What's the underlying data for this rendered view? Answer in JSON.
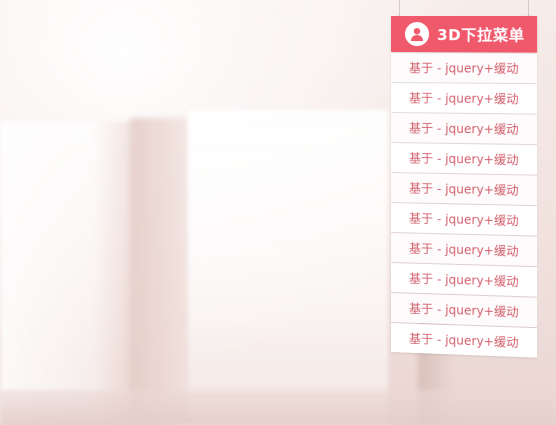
{
  "menu": {
    "title": "3D下拉菜单",
    "icon": "user-icon",
    "accent_color": "#f0586b",
    "item_text_color": "#d45f6c",
    "items": [
      {
        "label": "基于 - jquery+缓动"
      },
      {
        "label": "基于 - jquery+缓动"
      },
      {
        "label": "基于 - jquery+缓动"
      },
      {
        "label": "基于 - jquery+缓动"
      },
      {
        "label": "基于 - jquery+缓动"
      },
      {
        "label": "基于 - jquery+缓动"
      },
      {
        "label": "基于 - jquery+缓动"
      },
      {
        "label": "基于 - jquery+缓动"
      },
      {
        "label": "基于 - jquery+缓动"
      },
      {
        "label": "基于 - jquery+缓动"
      }
    ]
  }
}
